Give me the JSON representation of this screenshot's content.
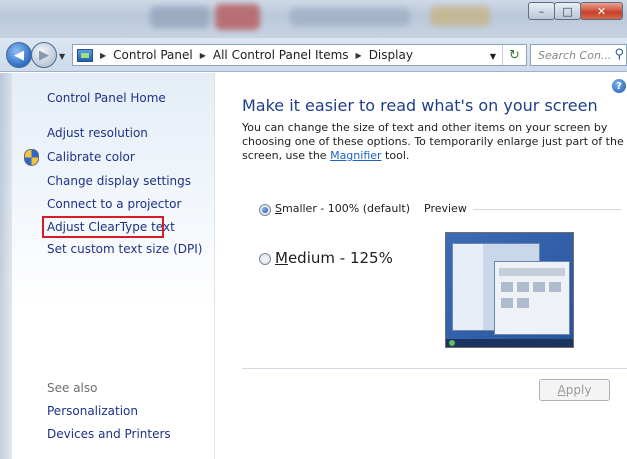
{
  "window": {
    "minimize": "–",
    "maximize": "□",
    "close": "✕"
  },
  "nav": {
    "back_glyph": "◀",
    "forward_glyph": "▶",
    "address": {
      "crumbs": [
        "Control Panel",
        "All Control Panel Items",
        "Display"
      ],
      "icon": "control-panel-icon"
    },
    "search_placeholder": "Search Con...",
    "refresh_glyph": "↻"
  },
  "sidebar": {
    "home": "Control Panel Home",
    "items": [
      {
        "label": "Adjust resolution"
      },
      {
        "label": "Calibrate color",
        "icon": "shield-icon"
      },
      {
        "label": "Change display settings"
      },
      {
        "label": "Connect to a projector"
      },
      {
        "label": "Adjust ClearType text",
        "highlighted": true,
        "highlight_color": "#d21e27"
      },
      {
        "label": "Set custom text size (DPI)"
      }
    ],
    "see_also_title": "See also",
    "see_also": [
      "Personalization",
      "Devices and Printers"
    ]
  },
  "main": {
    "help_glyph": "?",
    "heading": "Make it easier to read what's on your screen",
    "description_before": "You can change the size of text and other items on your screen by choosing one of these options. To temporarily enlarge just part of the screen, use the ",
    "magnifier_link": "Magnifier",
    "description_after": " tool.",
    "options": [
      {
        "accel": "S",
        "rest": "maller - 100% (default)",
        "selected": true
      },
      {
        "accel": "M",
        "rest": "edium - 125%",
        "selected": false
      }
    ],
    "preview_label": "Preview",
    "apply_accel": "A",
    "apply_rest": "pply",
    "apply_enabled": false
  },
  "colors": {
    "link": "#1e3287",
    "heading": "#1f3e8a",
    "highlight": "#d21e27"
  }
}
